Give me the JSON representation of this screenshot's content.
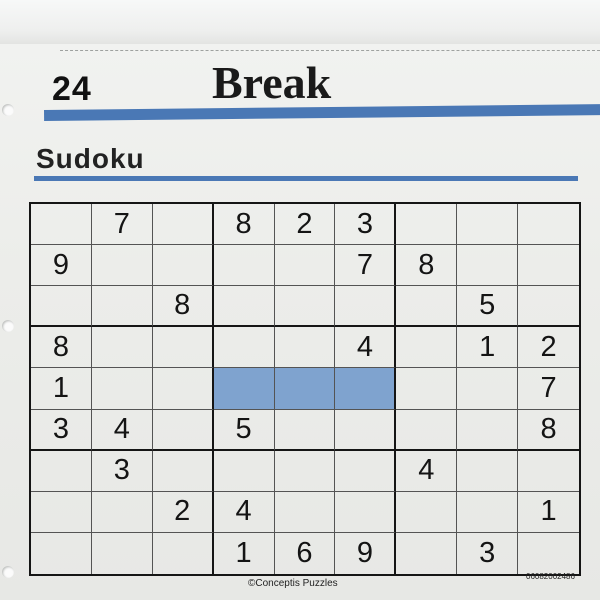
{
  "header": {
    "page_number": "24",
    "section_title": "Break"
  },
  "puzzle": {
    "title": "Sudoku",
    "grid": [
      [
        "",
        "7",
        "",
        "8",
        "2",
        "3",
        "",
        "",
        ""
      ],
      [
        "9",
        "",
        "",
        "",
        "",
        "7",
        "8",
        "",
        ""
      ],
      [
        "",
        "",
        "8",
        "",
        "",
        "",
        "",
        "5",
        ""
      ],
      [
        "8",
        "",
        "",
        "",
        "",
        "4",
        "",
        "1",
        "2"
      ],
      [
        "1",
        "",
        "",
        "",
        "",
        "",
        "",
        "",
        "7"
      ],
      [
        "3",
        "4",
        "",
        "5",
        "",
        "",
        "",
        "",
        "8"
      ],
      [
        "",
        "3",
        "",
        "",
        "",
        "",
        "4",
        "",
        ""
      ],
      [
        "",
        "",
        "2",
        "4",
        "",
        "",
        "",
        "",
        "1"
      ],
      [
        "",
        "",
        "",
        "1",
        "6",
        "9",
        "",
        "3",
        ""
      ]
    ],
    "highlighted_cells": [
      [
        4,
        3
      ],
      [
        4,
        4
      ],
      [
        4,
        5
      ]
    ],
    "highlight_color": "#7fa3cf"
  },
  "footer": {
    "copyright": "©Conceptis Puzzles",
    "code": "06082002486"
  },
  "colors": {
    "accent_rule": "#4a78b5",
    "paper": "#eeefec",
    "ink": "#141414"
  }
}
